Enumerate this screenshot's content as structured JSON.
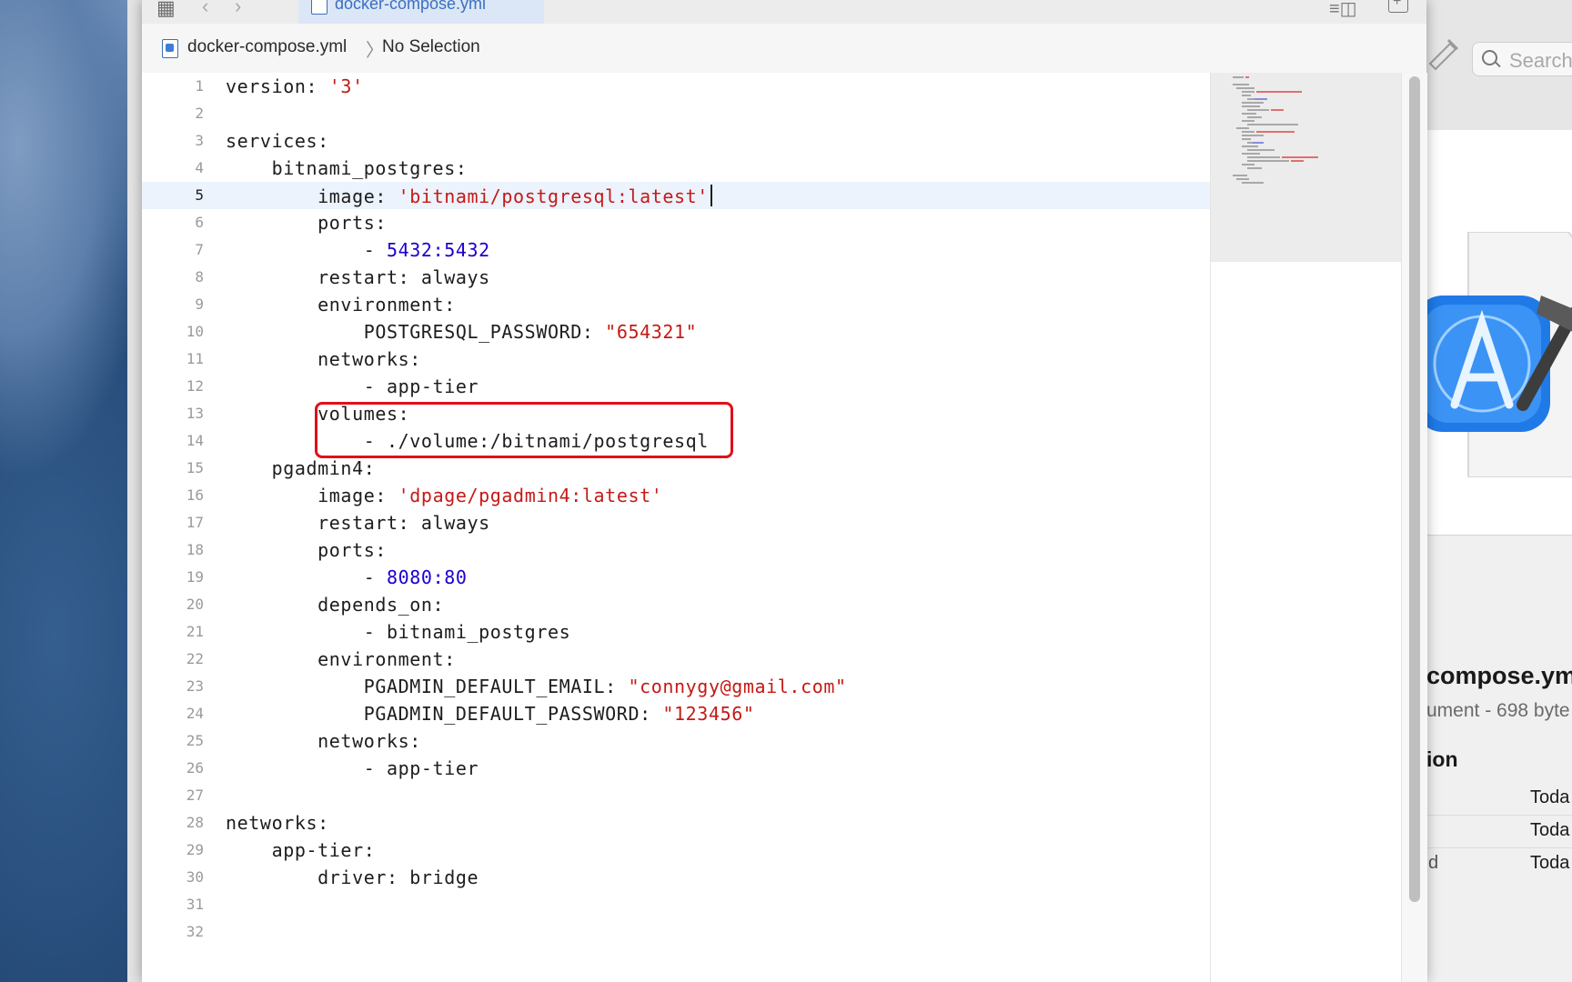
{
  "editor": {
    "tab_title": "docker-compose.yml",
    "breadcrumb_file": "docker-compose.yml",
    "breadcrumb_selection": "No Selection",
    "current_line": 5,
    "highlighted_lines": [
      13,
      14
    ],
    "lines": [
      {
        "num": "1",
        "indent": "",
        "key": "version:",
        "val": " '3'",
        "type": "string"
      },
      {
        "num": "2",
        "indent": "",
        "key": "",
        "val": "",
        "type": "plain"
      },
      {
        "num": "3",
        "indent": "",
        "key": "services:",
        "val": "",
        "type": "plain"
      },
      {
        "num": "4",
        "indent": "    ",
        "key": "bitnami_postgres:",
        "val": "",
        "type": "plain"
      },
      {
        "num": "5",
        "indent": "        ",
        "key": "image:",
        "val": " 'bitnami/postgresql:latest'",
        "type": "string"
      },
      {
        "num": "6",
        "indent": "        ",
        "key": "ports:",
        "val": "",
        "type": "plain"
      },
      {
        "num": "7",
        "indent": "            ",
        "key": "- ",
        "val": "5432:5432",
        "type": "number"
      },
      {
        "num": "8",
        "indent": "        ",
        "key": "restart: always",
        "val": "",
        "type": "plain"
      },
      {
        "num": "9",
        "indent": "        ",
        "key": "environment:",
        "val": "",
        "type": "plain"
      },
      {
        "num": "10",
        "indent": "            ",
        "key": "POSTGRESQL_PASSWORD:",
        "val": " \"654321\"",
        "type": "string"
      },
      {
        "num": "11",
        "indent": "        ",
        "key": "networks:",
        "val": "",
        "type": "plain"
      },
      {
        "num": "12",
        "indent": "            ",
        "key": "- app-tier",
        "val": "",
        "type": "plain"
      },
      {
        "num": "13",
        "indent": "        ",
        "key": "volumes:",
        "val": "",
        "type": "plain"
      },
      {
        "num": "14",
        "indent": "            ",
        "key": "- ./volume:/bitnami/postgresql",
        "val": "",
        "type": "plain"
      },
      {
        "num": "15",
        "indent": "    ",
        "key": "pgadmin4:",
        "val": "",
        "type": "plain"
      },
      {
        "num": "16",
        "indent": "        ",
        "key": "image:",
        "val": " 'dpage/pgadmin4:latest'",
        "type": "string"
      },
      {
        "num": "17",
        "indent": "        ",
        "key": "restart: always",
        "val": "",
        "type": "plain"
      },
      {
        "num": "18",
        "indent": "        ",
        "key": "ports:",
        "val": "",
        "type": "plain"
      },
      {
        "num": "19",
        "indent": "            ",
        "key": "- ",
        "val": "8080:80",
        "type": "number"
      },
      {
        "num": "20",
        "indent": "        ",
        "key": "depends_on:",
        "val": "",
        "type": "plain"
      },
      {
        "num": "21",
        "indent": "            ",
        "key": "- bitnami_postgres",
        "val": "",
        "type": "plain"
      },
      {
        "num": "22",
        "indent": "        ",
        "key": "environment:",
        "val": "",
        "type": "plain"
      },
      {
        "num": "23",
        "indent": "            ",
        "key": "PGADMIN_DEFAULT_EMAIL:",
        "val": " \"connygy@gmail.com\"",
        "type": "string"
      },
      {
        "num": "24",
        "indent": "            ",
        "key": "PGADMIN_DEFAULT_PASSWORD:",
        "val": " \"123456\"",
        "type": "string"
      },
      {
        "num": "25",
        "indent": "        ",
        "key": "networks:",
        "val": "",
        "type": "plain"
      },
      {
        "num": "26",
        "indent": "            ",
        "key": "- app-tier",
        "val": "",
        "type": "plain"
      },
      {
        "num": "27",
        "indent": "",
        "key": "",
        "val": "",
        "type": "plain"
      },
      {
        "num": "28",
        "indent": "",
        "key": "networks:",
        "val": "",
        "type": "plain"
      },
      {
        "num": "29",
        "indent": "    ",
        "key": "app-tier:",
        "val": "",
        "type": "plain"
      },
      {
        "num": "30",
        "indent": "        ",
        "key": "driver: bridge",
        "val": "",
        "type": "plain"
      },
      {
        "num": "31",
        "indent": "",
        "key": "",
        "val": "",
        "type": "plain"
      },
      {
        "num": "32",
        "indent": "",
        "key": "",
        "val": "",
        "type": "plain"
      }
    ]
  },
  "inspector": {
    "search_placeholder": "Search",
    "file_name": "compose.ym",
    "file_kind": "ument - 698 byte",
    "section_title": "ion",
    "rows": [
      {
        "label": "",
        "value": "Toda"
      },
      {
        "label": "",
        "value": "Toda"
      },
      {
        "label": "d",
        "value": "Toda"
      }
    ]
  },
  "colors": {
    "string": "#c41a16",
    "number": "#1c00cf",
    "highlight_box": "#e0101a",
    "current_line_bg": "#ecf3fc"
  }
}
